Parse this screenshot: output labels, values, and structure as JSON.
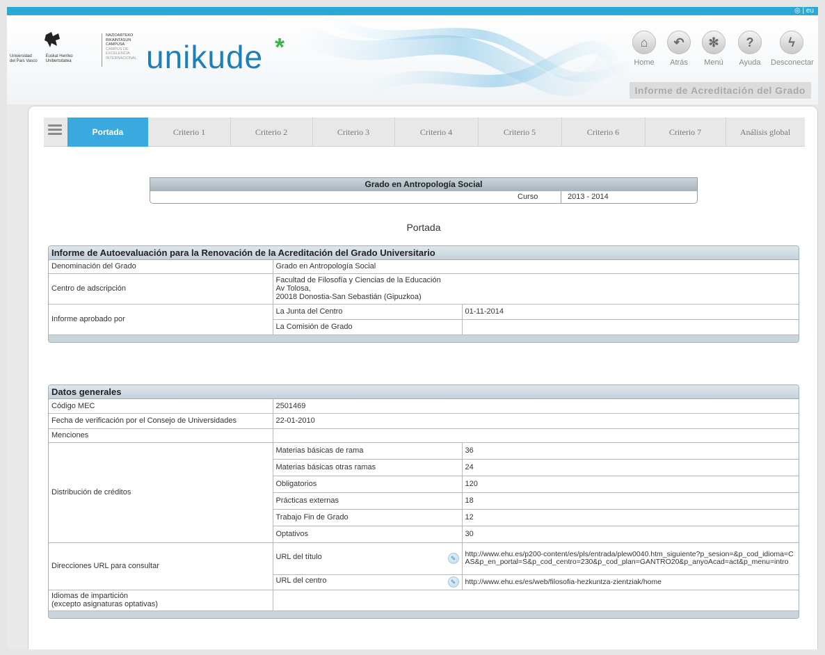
{
  "header": {
    "language_switch": "eu",
    "upv_name_lines": [
      "Universidad",
      "del País Vasco"
    ],
    "ehu_name_lines": [
      "Euskal Herriko",
      "Unibertsitatea"
    ],
    "campus_lines": [
      "NAZIOARTEKO",
      "BIKAINTASUN",
      "CAMPUSA",
      "CAMPUS DE",
      "EXCELENCIA",
      "INTERNACIONAL"
    ],
    "brand": "unikude",
    "brand_mark": "*",
    "nav": [
      {
        "label": "Home",
        "icon": "home-icon",
        "glyph": "⌂"
      },
      {
        "label": "Atrás",
        "icon": "back-icon",
        "glyph": "↶"
      },
      {
        "label": "Menú",
        "icon": "menu-star-icon",
        "glyph": "✻"
      },
      {
        "label": "Ayuda",
        "icon": "help-icon",
        "glyph": "?"
      },
      {
        "label": "Desconectar",
        "icon": "lightning-icon",
        "glyph": "ϟ"
      }
    ],
    "report_title": "Informe de Acreditación del Grado"
  },
  "tabs": [
    {
      "label": "Portada",
      "active": true
    },
    {
      "label": "Criterio 1"
    },
    {
      "label": "Criterio 2"
    },
    {
      "label": "Criterio 3"
    },
    {
      "label": "Criterio 4"
    },
    {
      "label": "Criterio 5"
    },
    {
      "label": "Criterio 6"
    },
    {
      "label": "Criterio 7"
    },
    {
      "label": "Análisis global"
    }
  ],
  "degree": {
    "title": "Grado en Antropología Social",
    "curso_label": "Curso",
    "curso_value": "2013 - 2014"
  },
  "page_heading": "Portada",
  "autoeval": {
    "title": "Informe de Autoevaluación para la Renovación de la Acreditación del Grado Universitario",
    "denominacion_label": "Denominación del Grado",
    "denominacion_value": "Grado en Antropología Social",
    "centro_label": "Centro de adscripción",
    "centro_lines": [
      "Facultad de Filosofía y Ciencias de la Educación",
      "Av Tolosa,",
      "20018  Donostia-San Sebastián  (Gipuzkoa)"
    ],
    "aprobado_label": "Informe aprobado por",
    "junta_label": "La Junta del Centro",
    "junta_value": "01-11-2014",
    "comision_label": "La Comisión de Grado",
    "comision_value": ""
  },
  "datos": {
    "title": "Datos generales",
    "codigo_label": "Código MEC",
    "codigo_value": "2501469",
    "fecha_label": "Fecha de verificación por el Consejo de Universidades",
    "fecha_value": "22-01-2010",
    "menciones_label": "Menciones",
    "menciones_value": "",
    "creditos_label": "Distribución de créditos",
    "creditos": [
      {
        "label": "Materias básicas de rama",
        "value": "36"
      },
      {
        "label": "Materias básicas otras ramas",
        "value": "24"
      },
      {
        "label": "Obligatorios",
        "value": "120"
      },
      {
        "label": "Prácticas externas",
        "value": "18"
      },
      {
        "label": "Trabajo Fin de Grado",
        "value": "12"
      },
      {
        "label": "Optativos",
        "value": "30"
      }
    ],
    "urls_label": "Direcciones URL para consultar",
    "url_titulo_label": "URL del título",
    "url_titulo_value": "http://www.ehu.es/p200-content/es/pls/entrada/plew0040.htm_siguiente?p_sesion=&p_cod_idioma=CAS&p_en_portal=S&p_cod_centro=230&p_cod_plan=GANTRO20&p_anyoAcad=act&p_menu=intro",
    "url_centro_label": "URL del centro",
    "url_centro_value": "http://www.ehu.es/es/web/filosofia-hezkuntza-zientziak/home",
    "idiomas_label_lines": [
      "Idiomas de impartición",
      "(excepto asignaturas optativas)"
    ],
    "idiomas_value": ""
  },
  "colors": {
    "accent": "#3aa9e0",
    "brand": "#1f7fb8",
    "brand_mark": "#39b54a",
    "panel_header": "#c4d1da"
  }
}
